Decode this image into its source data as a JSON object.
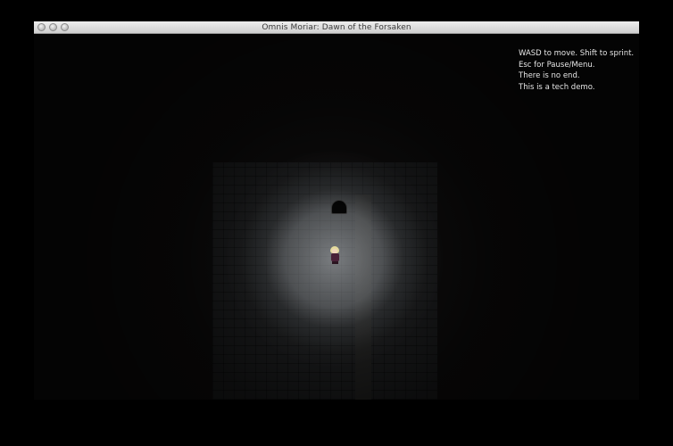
{
  "window": {
    "title": "Omnis Moriar: Dawn of the Forsaken"
  },
  "hud": {
    "lines": [
      "WASD to move. Shift to sprint.",
      "Esc for Pause/Menu.",
      "There is no end.",
      "This is a tech demo."
    ]
  },
  "colors": {
    "background": "#000000",
    "floor": "#1a1b1c",
    "hud_text": "#e6e6e6",
    "player_hair": "#e9dfa0",
    "player_robe": "#4a2138"
  },
  "icons": {
    "close": "close-button-icon",
    "minimize": "minimize-button-icon",
    "zoom": "zoom-button-icon"
  }
}
